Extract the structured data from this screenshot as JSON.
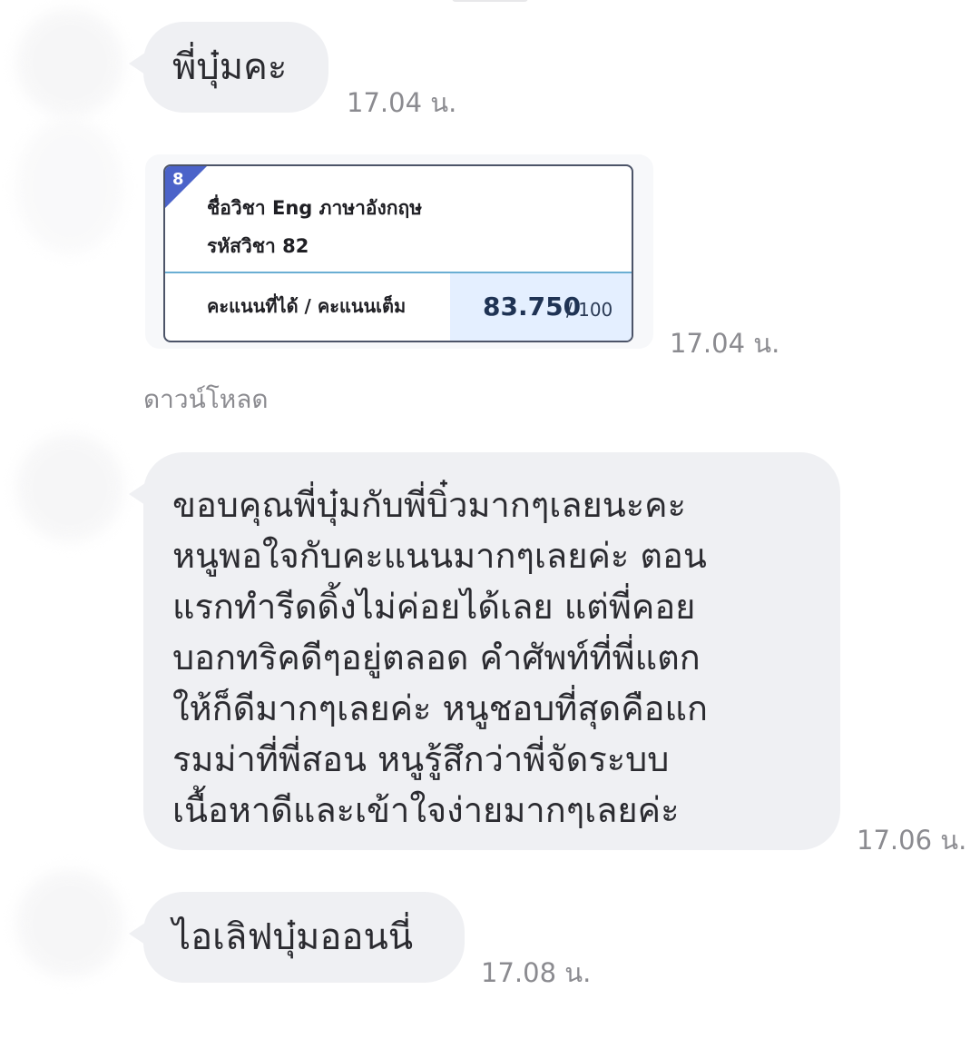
{
  "messages": [
    {
      "text": "พี่บุ๋มคะ",
      "time": "17.04 น."
    },
    {
      "image": {
        "number": "8",
        "subject": "ชื่อวิชา Eng ภาษาอังกฤษ",
        "code": "รหัสวิชา 82",
        "score_label": "คะแนนที่ได้ / คะแนนเต็ม",
        "score": "83.750",
        "max": "/ 100"
      },
      "time": "17.04 น.",
      "download": "ดาวน์โหลด"
    },
    {
      "text": "ขอบคุณพี่บุ๋มกับพี่บิ๋วมากๆเลยนะคะ\nหนูพอใจกับคะแนนมากๆเลยค่ะ ตอน\nแรกทำรีดดิ้งไม่ค่อยได้เลย แต่พี่คอย\nบอกทริคดีๆอยู่ตลอด คำศัพท์ที่พี่แตก\nให้ก็ดีมากๆเลยค่ะ หนูชอบที่สุดคือแก\nรมม่าที่พี่สอน หนูรู้สึกว่าพี่จัดระบบ\nเนื้อหาดีและเข้าใจง่ายมากๆเลยค่ะ",
      "time": "17.06 น."
    },
    {
      "text": "ไอเลิฟบุ๋มออนนี่",
      "time": "17.08 น."
    }
  ],
  "colors": {
    "bubble": "#eff0f3",
    "timestamp": "#8b8b90",
    "card_accent": "#4b63c9",
    "score_bg": "#e4efff"
  }
}
